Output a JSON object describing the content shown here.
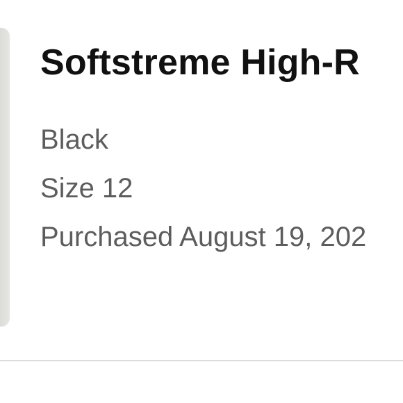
{
  "order_item": {
    "title": "Softstreme High-R",
    "color": "Black",
    "size": "Size 12",
    "purchased": "Purchased August 19, 202"
  }
}
